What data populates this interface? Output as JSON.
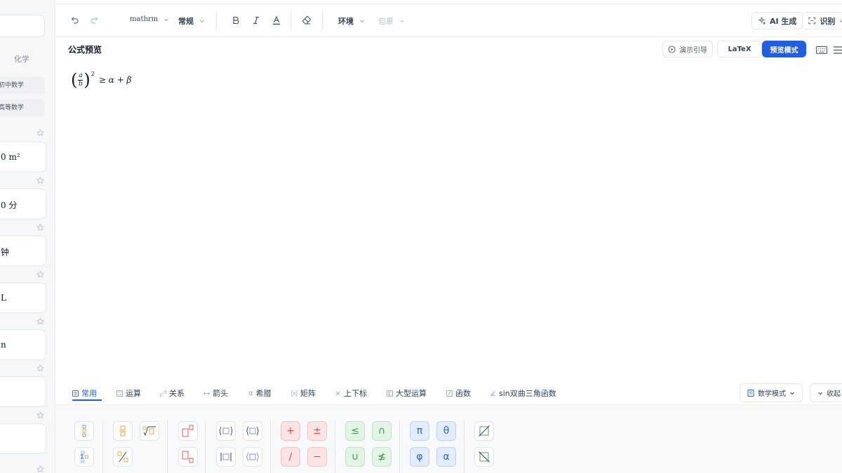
{
  "sidebar": {
    "tab_label": "化学",
    "chips": [
      "初中数学",
      "高等数学"
    ],
    "cards": [
      "0 m²",
      "0 分",
      "钟",
      "L",
      "n",
      "",
      ""
    ]
  },
  "toolbar": {
    "font_family": "mathrm",
    "font_style": "常规",
    "environment": "环境",
    "wrap": "包裹",
    "ai_label": "AI 生成",
    "recognize_label": "识别"
  },
  "preview": {
    "title": "公式预览",
    "guide_label": "演示引导",
    "latex_label": "LaTeX",
    "preview_mode_label": "预览模式",
    "formula": {
      "numerator": "a",
      "denominator": "b",
      "exponent": "2",
      "rest": "≥ α + β"
    }
  },
  "tabs": {
    "items": [
      "常用",
      "运算",
      "关系",
      "箭头",
      "希腊",
      "矩阵",
      "上下标",
      "大型运算",
      "函数",
      "sin双曲三角函数"
    ],
    "active": "常用",
    "mode_label": "数学模式",
    "collapse_label": "收起"
  },
  "palette": {
    "operators": [
      "+",
      "±",
      "/",
      "−"
    ],
    "relations": [
      "≤",
      "∩",
      "∪",
      "≰"
    ],
    "greek": [
      "π",
      "θ",
      "φ",
      "α"
    ]
  },
  "colors": {
    "accent": "#1f5fe0",
    "red": "#dc4b4b",
    "green": "#3f9b4e",
    "blue": "#2c62cf"
  }
}
